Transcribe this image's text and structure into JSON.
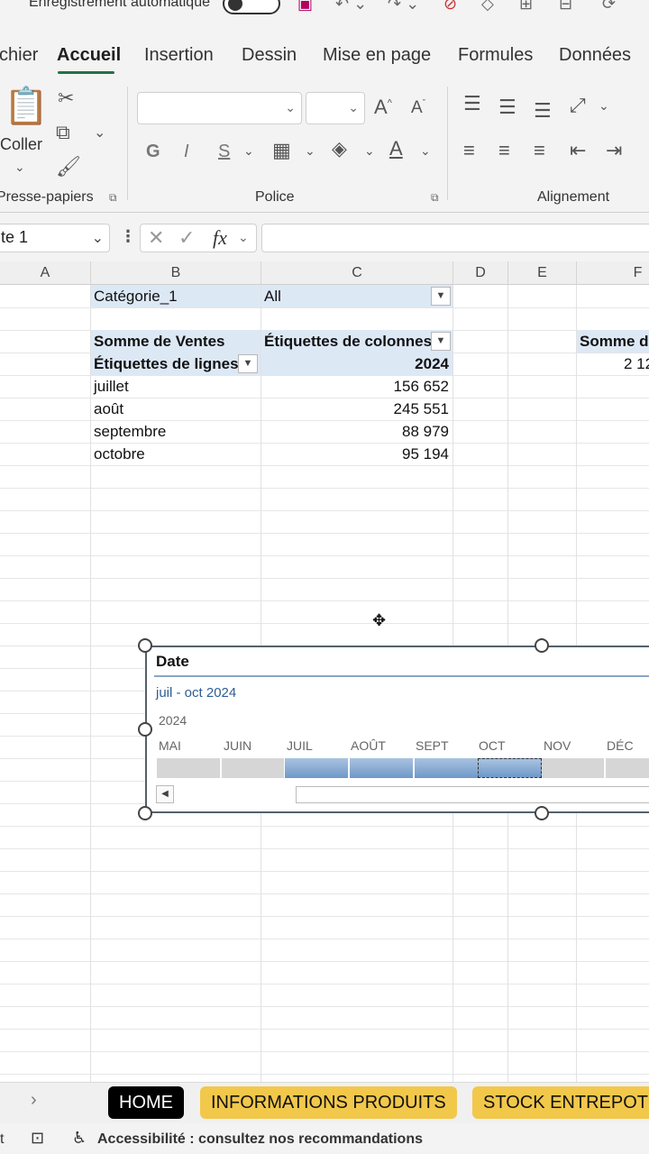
{
  "titlebar": {
    "autosave_label": "Enregistrement automatique",
    "icons": [
      "save-icon",
      "undo-icon",
      "redo-icon",
      "clear-filter-icon",
      "format-icon",
      "group-icon",
      "refresh-icon"
    ]
  },
  "ribbon": {
    "tabs": [
      "chier",
      "Accueil",
      "Insertion",
      "Dessin",
      "Mise en page",
      "Formules",
      "Données"
    ],
    "active_tab": "Accueil",
    "clipboard": {
      "paste_label": "Coller",
      "group_label": "resse-papiers"
    },
    "font": {
      "group_label": "Police",
      "font_name": "",
      "font_size": "",
      "bold": "G",
      "italic": "I",
      "underline": "S",
      "grow": "A",
      "shrink": "A"
    },
    "alignment": {
      "group_label": "Alignement"
    }
  },
  "formula_bar": {
    "name_box": "te 1",
    "function_label": "fx",
    "formula": ""
  },
  "columns": [
    "A",
    "B",
    "C",
    "D",
    "E",
    "F"
  ],
  "pivot": {
    "filter_label": "Catégorie_1",
    "filter_value": "All",
    "values_header": "Somme de Ventes",
    "columns_header": "Étiquettes de colonnes",
    "rows_header": "Étiquettes de lignes",
    "year": "2024",
    "rows": [
      {
        "label": "juillet",
        "value": "156 652"
      },
      {
        "label": "août",
        "value": "245 551"
      },
      {
        "label": "septembre",
        "value": "88 979"
      },
      {
        "label": "octobre",
        "value": "95 194"
      }
    ],
    "side_header": "Somme de",
    "side_value": "2 12"
  },
  "timeline": {
    "title": "Date",
    "range": "juil - oct 2024",
    "year": "2024",
    "months": [
      "MAI",
      "JUIN",
      "JUIL",
      "AOÛT",
      "SEPT",
      "OCT",
      "NOV",
      "DÉC"
    ],
    "selected_months": [
      "JUIL",
      "AOÛT",
      "SEPT",
      "OCT"
    ]
  },
  "sheet_tabs": [
    {
      "label": "HOME",
      "style": "active"
    },
    {
      "label": "INFORMATIONS PRODUITS",
      "style": "yellow"
    },
    {
      "label": "STOCK ENTREPOT",
      "style": "yellow"
    }
  ],
  "statusbar": {
    "left_text": "t",
    "accessibility": "Accessibilité : consultez nos recommandations"
  },
  "colors": {
    "excel_green": "#217346",
    "pivot_header": "#dde8f5",
    "tab_yellow": "#f2c84b",
    "timeline_blue": "#6e98c8"
  }
}
